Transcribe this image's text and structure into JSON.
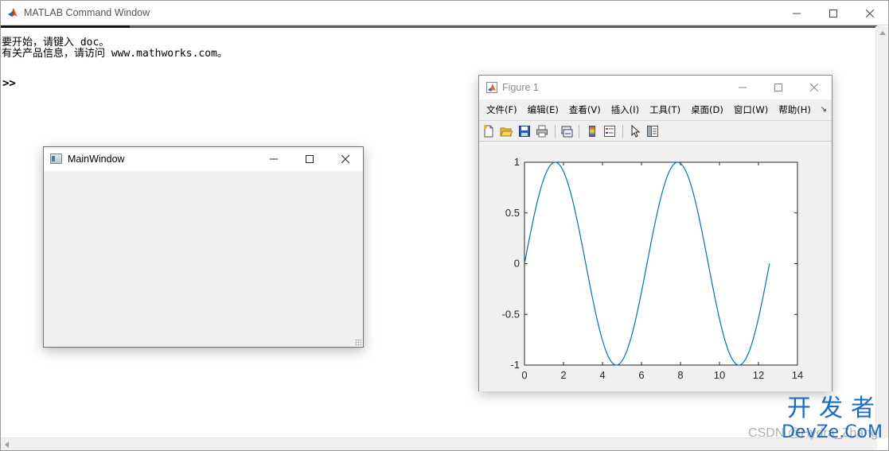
{
  "command_window": {
    "title": "MATLAB Command Window",
    "console_lines": [
      "要开始，请键入 doc。",
      "有关产品信息，请访问 www.mathworks.com。"
    ],
    "prompt": ">>"
  },
  "qt_window": {
    "title": "MainWindow"
  },
  "figure": {
    "title": "Figure 1",
    "menu": [
      "文件(F)",
      "编辑(E)",
      "查看(V)",
      "插入(I)",
      "工具(T)",
      "桌面(D)",
      "窗口(W)",
      "帮助(H)"
    ],
    "toolbar_icons": [
      "new-figure-icon",
      "open-folder-icon",
      "save-icon",
      "print-icon",
      "link-plot-icon",
      "colorbar-icon",
      "legend-icon",
      "pointer-icon",
      "property-inspector-icon"
    ]
  },
  "chart_data": {
    "type": "line",
    "title": "",
    "xlabel": "",
    "ylabel": "",
    "xlim": [
      0,
      14
    ],
    "ylim": [
      -1,
      1
    ],
    "xticks": [
      0,
      2,
      4,
      6,
      8,
      10,
      12,
      14
    ],
    "yticks": [
      1,
      0.5,
      0,
      -0.5,
      -1
    ],
    "series": [
      {
        "function": "sin(x)",
        "x_range": [
          0,
          12.566
        ],
        "color": "#0072bd"
      }
    ]
  },
  "watermark": {
    "main": "开发者",
    "sub": "DevZe.CoM",
    "csdn": "CSDN @Hydra_Zhang"
  },
  "colors": {
    "matlab_line_blue": "#0072bd",
    "watermark_blue": "#1a6ec2",
    "window_bg": "#f0f0f0"
  }
}
